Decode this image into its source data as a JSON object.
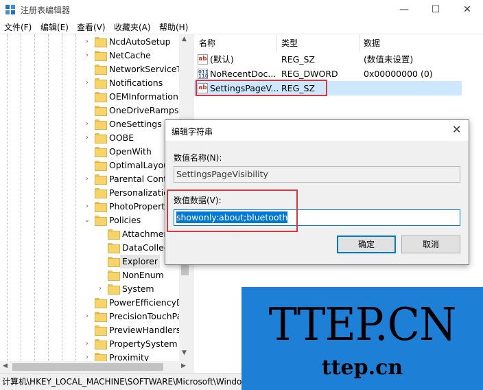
{
  "window": {
    "title": "注册表编辑器",
    "minimize": "—",
    "maximize": "☐",
    "close": "✕"
  },
  "menu": [
    "文件(F)",
    "编辑(E)",
    "查看(V)",
    "收藏夹(A)",
    "帮助(H)"
  ],
  "tree": {
    "items": [
      {
        "label": "NcdAutoSetup",
        "arrow": "›"
      },
      {
        "label": "NetCache",
        "arrow": "›"
      },
      {
        "label": "NetworkServiceTi",
        "arrow": ""
      },
      {
        "label": "Notifications",
        "arrow": "›"
      },
      {
        "label": "OEMInformation",
        "arrow": ""
      },
      {
        "label": "OneDriveRamps",
        "arrow": ""
      },
      {
        "label": "OneSettings",
        "arrow": "›"
      },
      {
        "label": "OOBE",
        "arrow": "›"
      },
      {
        "label": "OpenWith",
        "arrow": ""
      },
      {
        "label": "OptimalLayout",
        "arrow": ""
      },
      {
        "label": "Parental Contro",
        "arrow": "›"
      },
      {
        "label": "Personalization",
        "arrow": ""
      },
      {
        "label": "PhotoProperty",
        "arrow": "›"
      },
      {
        "label": "Policies",
        "arrow": "⌄"
      },
      {
        "label": "Attachmen",
        "arrow": ""
      },
      {
        "label": "DataCollec",
        "arrow": ""
      },
      {
        "label": "Explorer",
        "arrow": ""
      },
      {
        "label": "NonEnum",
        "arrow": ""
      },
      {
        "label": "System",
        "arrow": "›"
      },
      {
        "label": "PowerEfficiencyDi",
        "arrow": ""
      },
      {
        "label": "PrecisionTouchPa",
        "arrow": "›"
      },
      {
        "label": "PreviewHandlers",
        "arrow": ""
      },
      {
        "label": "PropertySystem",
        "arrow": "›"
      },
      {
        "label": "Proximity",
        "arrow": "›"
      }
    ]
  },
  "list": {
    "headers": [
      "名称",
      "类型",
      "数据"
    ],
    "rows": [
      {
        "icon": "ab",
        "name": "(默认)",
        "type": "REG_SZ",
        "data": "(数值未设置)"
      },
      {
        "icon": "bin",
        "name": "NoRecentDoc...",
        "type": "REG_DWORD",
        "data": "0x00000000 (0)"
      },
      {
        "icon": "ab",
        "name": "SettingsPageV...",
        "type": "REG_SZ",
        "data": ""
      }
    ]
  },
  "icons": {
    "string_value": "ab",
    "binary_value": "011\n110"
  },
  "dialog": {
    "title": "编辑字符串",
    "close": "✕",
    "name_label": "数值名称(N):",
    "name_value": "SettingsPageVisibility",
    "data_label": "数值数据(V):",
    "data_value": "showonly:about;bluetooth",
    "ok": "确定",
    "cancel": "取消"
  },
  "statusbar": {
    "path": "计算机\\HKEY_LOCAL_MACHINE\\SOFTWARE\\Microsoft\\Windo"
  },
  "watermark": {
    "big": "TTEP.CN",
    "small": "ttep.cn"
  },
  "colors": {
    "accent": "#0078d7",
    "highlight": "#cce8ff",
    "annotation": "#d9363e",
    "watermark_bg": "#1e7fd6"
  }
}
